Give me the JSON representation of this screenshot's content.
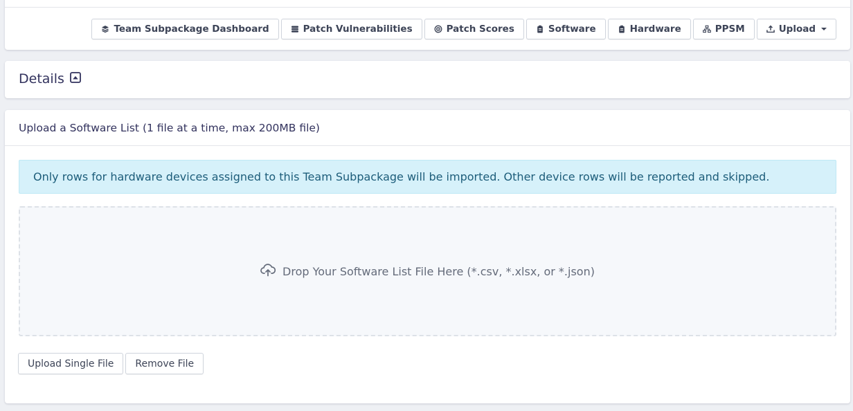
{
  "nav": {
    "buttons": [
      {
        "label": "Team Subpackage Dashboard",
        "icon": "layers-icon"
      },
      {
        "label": "Patch Vulnerabilities",
        "icon": "database-icon"
      },
      {
        "label": "Patch Scores",
        "icon": "target-icon"
      },
      {
        "label": "Software",
        "icon": "clipboard-icon"
      },
      {
        "label": "Hardware",
        "icon": "clipboard-icon"
      },
      {
        "label": "PPSM",
        "icon": "network-icon"
      },
      {
        "label": "Upload",
        "icon": "upload-icon",
        "dropdown": true
      }
    ]
  },
  "details": {
    "title": "Details",
    "toggle_icon": "caret-square-up-icon"
  },
  "upload": {
    "heading": "Upload a Software List (1 file at a time, max 200MB file)",
    "info_alert": "Only rows for hardware devices assigned to this Team Subpackage will be imported. Other device rows will be reported and skipped.",
    "dropzone_text": "Drop Your Software List File Here (*.csv, *.xlsx, or *.json)",
    "dropzone_icon": "cloud-upload-icon",
    "upload_button": "Upload Single File",
    "remove_button": "Remove File"
  },
  "colors": {
    "page_bg": "#eef0f4",
    "card_bg": "#ffffff",
    "alert_bg": "#d6f1fa",
    "alert_text": "#1d5d7a",
    "text": "#32325d"
  }
}
